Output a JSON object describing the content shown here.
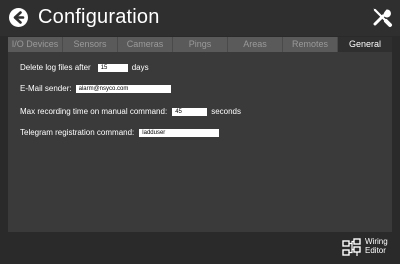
{
  "header": {
    "title": "Configuration",
    "back_icon": "back-arrow-icon",
    "tools_icon": "wrench-screwdriver-icon"
  },
  "tabs": [
    {
      "label": "I/O Devices",
      "active": false
    },
    {
      "label": "Sensors",
      "active": false
    },
    {
      "label": "Cameras",
      "active": false
    },
    {
      "label": "Pings",
      "active": false
    },
    {
      "label": "Areas",
      "active": false
    },
    {
      "label": "Remotes",
      "active": false
    },
    {
      "label": "General",
      "active": true
    }
  ],
  "general": {
    "delete_logs": {
      "label_before": "Delete log files after",
      "value": "15",
      "label_after": "days"
    },
    "email_sender": {
      "label": "E-Mail sender:",
      "value": "alarm@nsyco.com"
    },
    "max_recording": {
      "label_before": "Max recording time on manual command:",
      "value": "45",
      "label_after": "seconds"
    },
    "telegram": {
      "label": "Telegram registration command:",
      "value": "ladduser"
    }
  },
  "footer": {
    "wiring_editor_line1": "Wiring",
    "wiring_editor_line2": "Editor",
    "wiring_icon": "wiring-diagram-icon"
  },
  "colors": {
    "background": "#2a2a2a",
    "panel": "#3a3a3a",
    "tab_inactive": "#5a5a5a",
    "tab_active": "#2f2f2f",
    "text": "#ffffff"
  }
}
